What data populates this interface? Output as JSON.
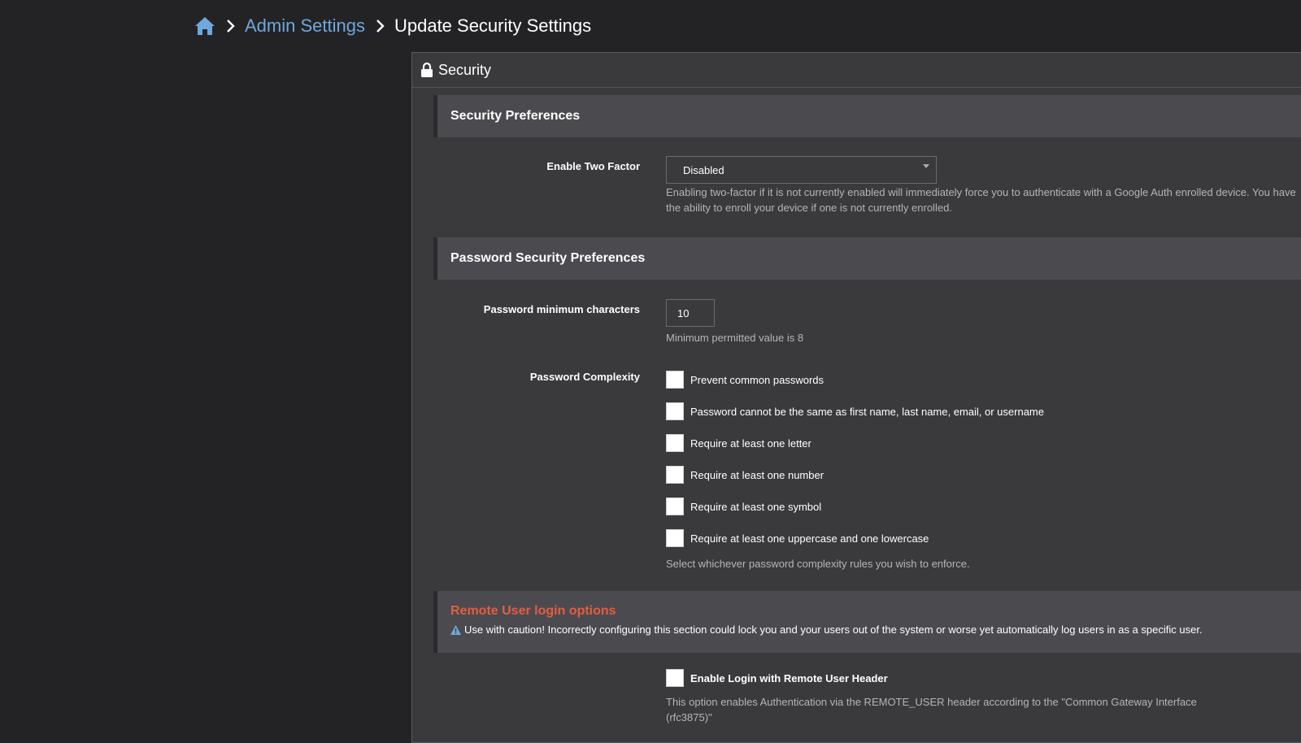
{
  "breadcrumb": {
    "home_icon": "home-icon",
    "admin_settings": "Admin Settings",
    "current": "Update Security Settings"
  },
  "panel": {
    "title": "Security",
    "icon": "lock-icon"
  },
  "security_preferences": {
    "title": "Security Preferences",
    "two_factor": {
      "label": "Enable Two Factor",
      "selected": "Disabled",
      "help": "Enabling two-factor if it is not currently enabled will immediately force you to authenticate with a Google Auth enrolled device. You have the ability to enroll your device if one is not currently enrolled."
    }
  },
  "password_security": {
    "title": "Password Security Preferences",
    "min_chars": {
      "label": "Password minimum characters",
      "value": "10",
      "help": "Minimum permitted value is 8"
    },
    "complexity": {
      "label": "Password Complexity",
      "options": [
        {
          "label": "Prevent common passwords",
          "checked": false
        },
        {
          "label": "Password cannot be the same as first name, last name, email, or username",
          "checked": false
        },
        {
          "label": "Require at least one letter",
          "checked": false
        },
        {
          "label": "Require at least one number",
          "checked": false
        },
        {
          "label": "Require at least one symbol",
          "checked": false
        },
        {
          "label": "Require at least one uppercase and one lowercase",
          "checked": false
        }
      ],
      "help": "Select whichever password complexity rules you wish to enforce."
    }
  },
  "remote_user": {
    "title": "Remote User login options",
    "warning": "Use with caution! Incorrectly configuring this section could lock you and your users out of the system or worse yet automatically log users in as a specific user.",
    "enable_label": "Enable Login with Remote User Header",
    "enable_checked": false,
    "help": "This option enables Authentication via the REMOTE_USER header according to the \"Common Gateway Interface (rfc3875)\""
  },
  "colors": {
    "background": "#232325",
    "panel": "#3a3a3d",
    "section_header": "#4b4b4f",
    "link": "#6fa8dc",
    "warning_title": "#e25d43"
  }
}
